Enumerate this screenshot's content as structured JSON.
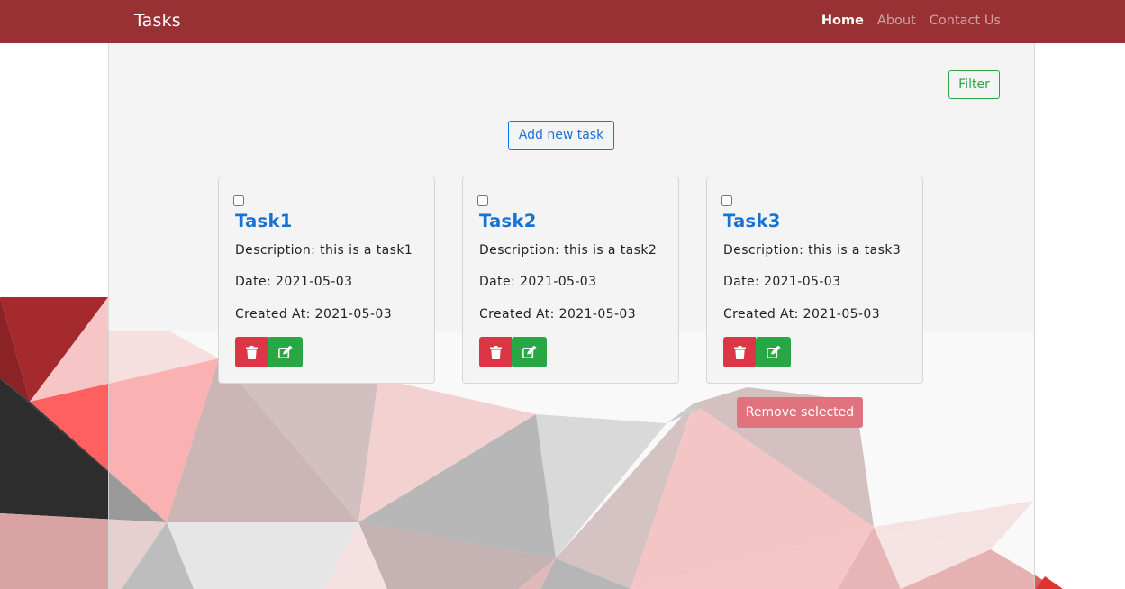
{
  "navbar": {
    "brand": "Tasks",
    "links": [
      {
        "label": "Home",
        "active": true
      },
      {
        "label": "About",
        "active": false
      },
      {
        "label": "Contact Us",
        "active": false
      }
    ]
  },
  "toolbar": {
    "filter_label": "Filter",
    "add_label": "Add new task",
    "remove_selected_label": "Remove selected"
  },
  "tasks": [
    {
      "title": "Task1",
      "description": "Description: this is a task1",
      "date": "Date: 2021-05-03",
      "created": "Created At: 2021-05-03",
      "checked": false
    },
    {
      "title": "Task2",
      "description": "Description: this is a task2",
      "date": "Date: 2021-05-03",
      "created": "Created At: 2021-05-03",
      "checked": false
    },
    {
      "title": "Task3",
      "description": "Description: this is a task3",
      "date": "Date: 2021-05-03",
      "created": "Created At: 2021-05-03",
      "checked": false
    }
  ],
  "icons": {
    "delete": "trash-icon",
    "edit": "edit-icon"
  },
  "colors": {
    "navbar": "#983133",
    "primary": "#007bff",
    "success": "#28a745",
    "danger": "#dc3545"
  }
}
